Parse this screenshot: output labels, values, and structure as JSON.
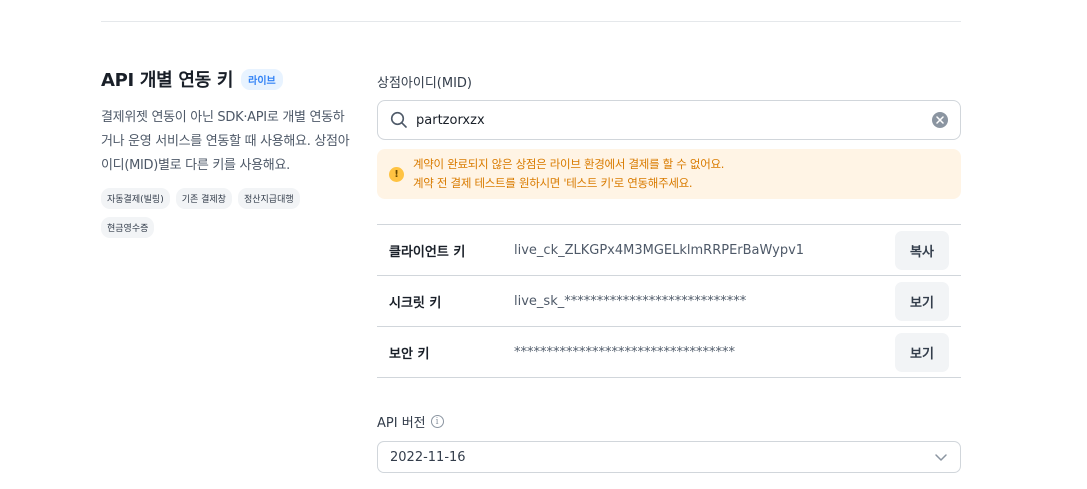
{
  "section": {
    "title": "API 개별 연동 키",
    "badge": "라이브",
    "description": "결제위젯 연동이 아닌 SDK·API로 개별 연동하거나 운영 서비스를 연동할 때 사용해요. 상점아이디(MID)별로 다른 키를 사용해요.",
    "tags": [
      "자동결제(빌링)",
      "기존 결제창",
      "정산지급대행",
      "현금영수증"
    ]
  },
  "mid": {
    "label": "상점아이디(MID)",
    "value": "partzorxzx",
    "icons": {
      "search": "search-icon",
      "clear": "clear-icon"
    }
  },
  "warning": {
    "icon": "exclamation-icon",
    "line1": "계약이 완료되지 않은 상점은 라이브 환경에서 결제를 할 수 없어요.",
    "line2": "계약 전 결제 테스트를 원하시면 '테스트 키'로 연동해주세요."
  },
  "keys": [
    {
      "label": "클라이언트 키",
      "value": "live_ck_ZLKGPx4M3MGELklmRRPErBaWypv1",
      "button": "복사"
    },
    {
      "label": "시크릿 키",
      "value": "live_sk_****************************",
      "button": "보기"
    },
    {
      "label": "보안 키",
      "value": "**********************************",
      "button": "보기"
    }
  ],
  "api_version": {
    "label": "API 버전",
    "selected": "2022-11-16"
  },
  "colors": {
    "accent": "#3182f6",
    "warning_bg": "#fff4e5",
    "warning_text": "#d97b00",
    "border": "#d1d6db"
  }
}
